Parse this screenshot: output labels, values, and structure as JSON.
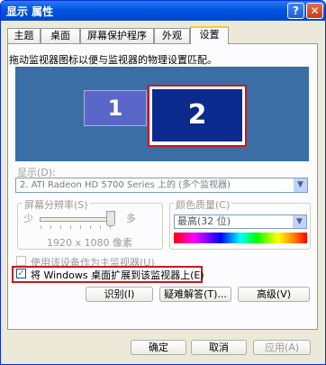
{
  "window": {
    "title": "显示 属性",
    "help_glyph": "?",
    "close_glyph": "✕"
  },
  "tabs": [
    {
      "label": "主题"
    },
    {
      "label": "桌面"
    },
    {
      "label": "屏幕保护程序"
    },
    {
      "label": "外观"
    },
    {
      "label": "设置"
    }
  ],
  "settings": {
    "instruction": "拖动监视器图标以便与监视器的物理设置匹配。",
    "monitors": [
      {
        "number": "1"
      },
      {
        "number": "2"
      }
    ],
    "display_label": "显示(D):",
    "display_value": "2. ATI Radeon HD 5700 Series 上的 (多个监视器)",
    "resolution": {
      "title": "屏幕分辨率(S)",
      "less": "少",
      "more": "多",
      "value": "1920 x 1080 像素",
      "level": 1.0
    },
    "color": {
      "title": "颜色质量(C)",
      "value": "最高(32 位)"
    },
    "primary_checkbox": {
      "label": "使用该设备作为主监视器(U)",
      "checked": false
    },
    "extend_checkbox": {
      "label": "将 Windows 桌面扩展到该监视器上(E)",
      "checked": true,
      "check_glyph": "✓"
    },
    "buttons": {
      "identify": "识别(I)",
      "troubleshoot": "疑难解答(T)...",
      "advanced": "高级(V)"
    }
  },
  "footer": {
    "ok": "确定",
    "cancel": "取消",
    "apply": "应用(A)"
  },
  "colors": {
    "title_bar": "#0054e3",
    "highlight_border": "#c9181e",
    "monitor_area": "#3a6ea5",
    "selected_monitor": "#0a2a8e"
  }
}
